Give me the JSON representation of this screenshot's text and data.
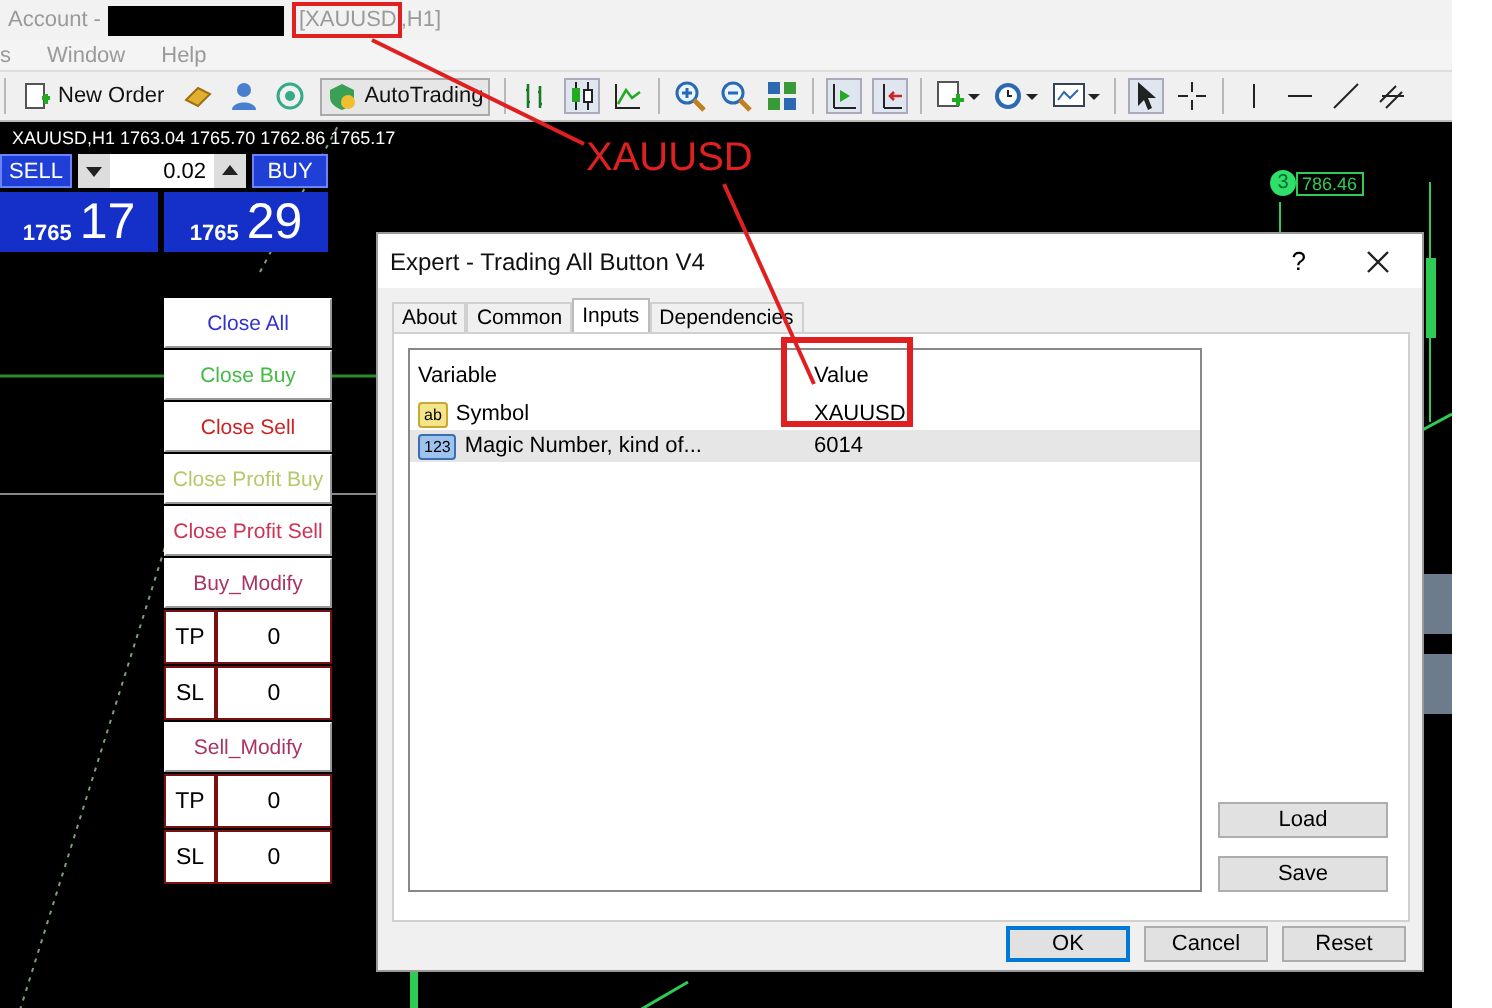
{
  "window": {
    "title_prefix": "Account -",
    "title_symbol": "[XAUUSD",
    "title_timeframe": ",H1]"
  },
  "menu": [
    {
      "label": "s"
    },
    {
      "label": "Window"
    },
    {
      "label": "Help"
    }
  ],
  "toolbar": {
    "new_order": "New Order",
    "autotrading": "AutoTrading"
  },
  "chart": {
    "header": "XAUUSD,H1  1763.04 1765.70 1762.86 1765.17",
    "marker": "3",
    "price_label": "786.46"
  },
  "trade_panel": {
    "sell": "SELL",
    "lot": "0.02",
    "buy": "BUY",
    "bid_big": "1765",
    "bid_small": "17",
    "ask_big": "1765",
    "ask_small": "29"
  },
  "button_panel": [
    {
      "kind": "button",
      "label": "Close All",
      "color": "#3333cc"
    },
    {
      "kind": "button",
      "label": "Close Buy",
      "color": "#44bb44"
    },
    {
      "kind": "button",
      "label": "Close Sell",
      "color": "#cc2222"
    },
    {
      "kind": "button",
      "label": "Close Profit Buy",
      "color": "#b5c96a"
    },
    {
      "kind": "button",
      "label": "Close Profit Sell",
      "color": "#cc3355"
    },
    {
      "kind": "button",
      "label": "Buy_Modify",
      "color": "#aa3366"
    },
    {
      "kind": "field",
      "label": "TP",
      "value": "0"
    },
    {
      "kind": "field",
      "label": "SL",
      "value": "0"
    },
    {
      "kind": "button",
      "label": "Sell_Modify",
      "color": "#aa3366"
    },
    {
      "kind": "field",
      "label": "TP",
      "value": "0"
    },
    {
      "kind": "field",
      "label": "SL",
      "value": "0"
    }
  ],
  "annotation": {
    "label": "XAUUSD"
  },
  "dialog": {
    "title": "Expert - Trading All Button V4",
    "help": "?",
    "tabs": [
      {
        "label": "About",
        "selected": false
      },
      {
        "label": "Common",
        "selected": false
      },
      {
        "label": "Inputs",
        "selected": true
      },
      {
        "label": "Dependencies",
        "selected": false
      }
    ],
    "columns": [
      "Variable",
      "Value"
    ],
    "rows": [
      {
        "kind": "string",
        "icon_text": "ab",
        "variable": "Symbol",
        "value": "XAUUSD",
        "selected": false
      },
      {
        "kind": "integer",
        "icon_text": "123",
        "variable": "Magic Number, kind of...",
        "value": "6014",
        "selected": true
      }
    ],
    "side_buttons": [
      "Load",
      "Save"
    ],
    "buttons": [
      {
        "label": "OK",
        "default": true
      },
      {
        "label": "Cancel",
        "default": false
      },
      {
        "label": "Reset",
        "default": false
      }
    ]
  }
}
